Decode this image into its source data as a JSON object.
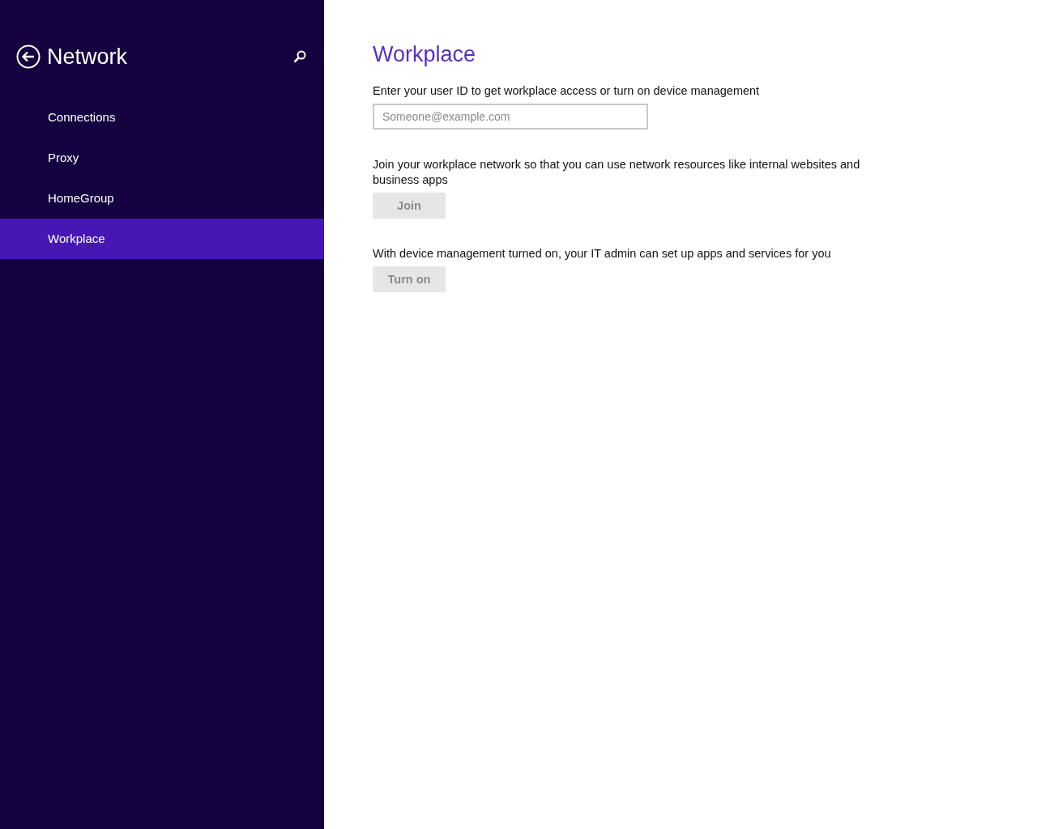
{
  "sidebar": {
    "title": "Network",
    "items": [
      {
        "label": "Connections",
        "selected": false
      },
      {
        "label": "Proxy",
        "selected": false
      },
      {
        "label": "HomeGroup",
        "selected": false
      },
      {
        "label": "Workplace",
        "selected": true
      }
    ]
  },
  "page": {
    "title": "Workplace",
    "user_id": {
      "label": "Enter your user ID to get workplace access or turn on device management",
      "placeholder": "Someone@example.com"
    },
    "sections": [
      {
        "description": "Join your workplace network so that you can use network resources like internal websites and business apps",
        "button": {
          "label": "Join",
          "disabled": true
        }
      },
      {
        "description": "With device management turned on, your IT admin can set up apps and services for you",
        "button": {
          "label": "Turn on",
          "disabled": true
        }
      }
    ]
  }
}
